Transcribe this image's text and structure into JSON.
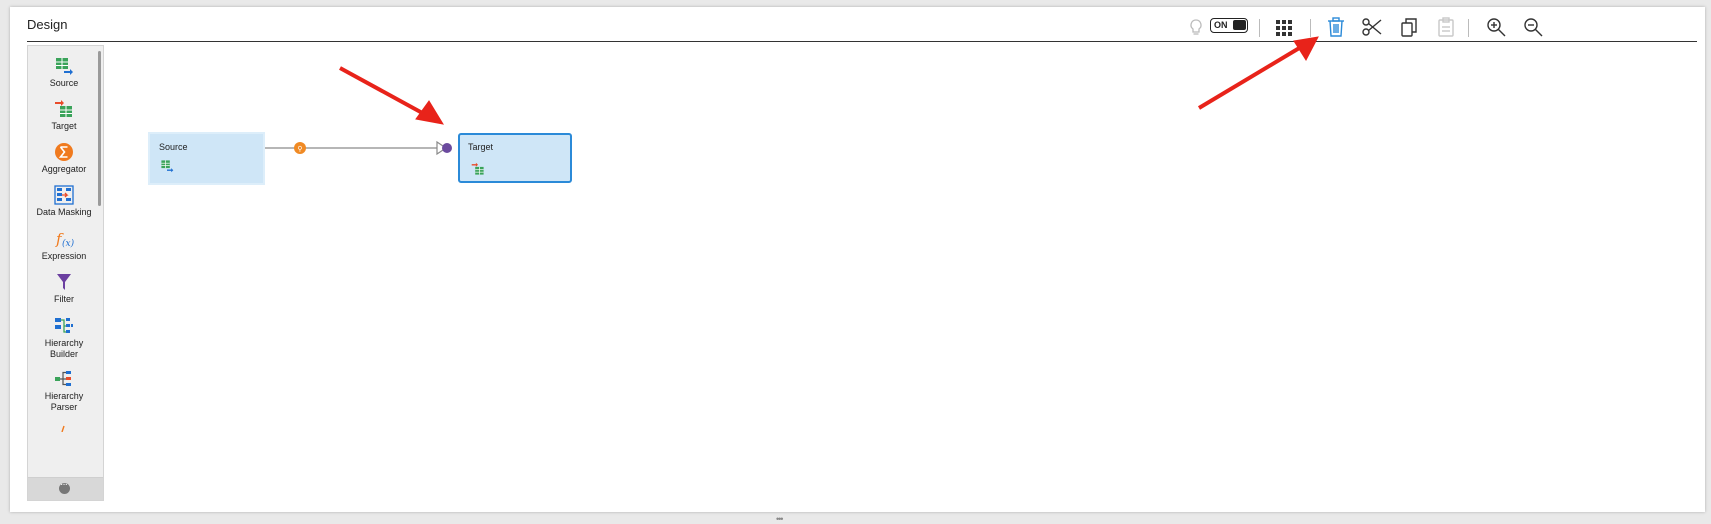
{
  "panel": {
    "title": "Design"
  },
  "toolbar": {
    "toggle_label": "ON",
    "icons": [
      "lightbulb-icon",
      "grid-icon",
      "delete-icon",
      "cut-icon",
      "copy-icon",
      "paste-icon",
      "zoom-in-icon",
      "zoom-out-icon"
    ]
  },
  "palette": {
    "items": [
      {
        "label": "Source",
        "icon": "source-icon"
      },
      {
        "label": "Target",
        "icon": "target-icon"
      },
      {
        "label": "Aggregator",
        "icon": "aggregator-icon"
      },
      {
        "label": "Data Masking",
        "icon": "data-masking-icon"
      },
      {
        "label": "Expression",
        "icon": "expression-icon"
      },
      {
        "label": "Filter",
        "icon": "filter-icon"
      },
      {
        "label": "Hierarchy\nBuilder",
        "icon": "hierarchy-builder-icon"
      },
      {
        "label": "Hierarchy\nParser",
        "icon": "hierarchy-parser-icon"
      }
    ]
  },
  "canvas": {
    "nodes": [
      {
        "label": "Source"
      },
      {
        "label": "Target"
      }
    ]
  },
  "colors": {
    "accent_blue": "#2b8ad8",
    "node_fill": "#cfe6f7",
    "arrow_red": "#e8231a",
    "link_purple": "#6b4a9e",
    "link_orange": "#f08a24"
  }
}
